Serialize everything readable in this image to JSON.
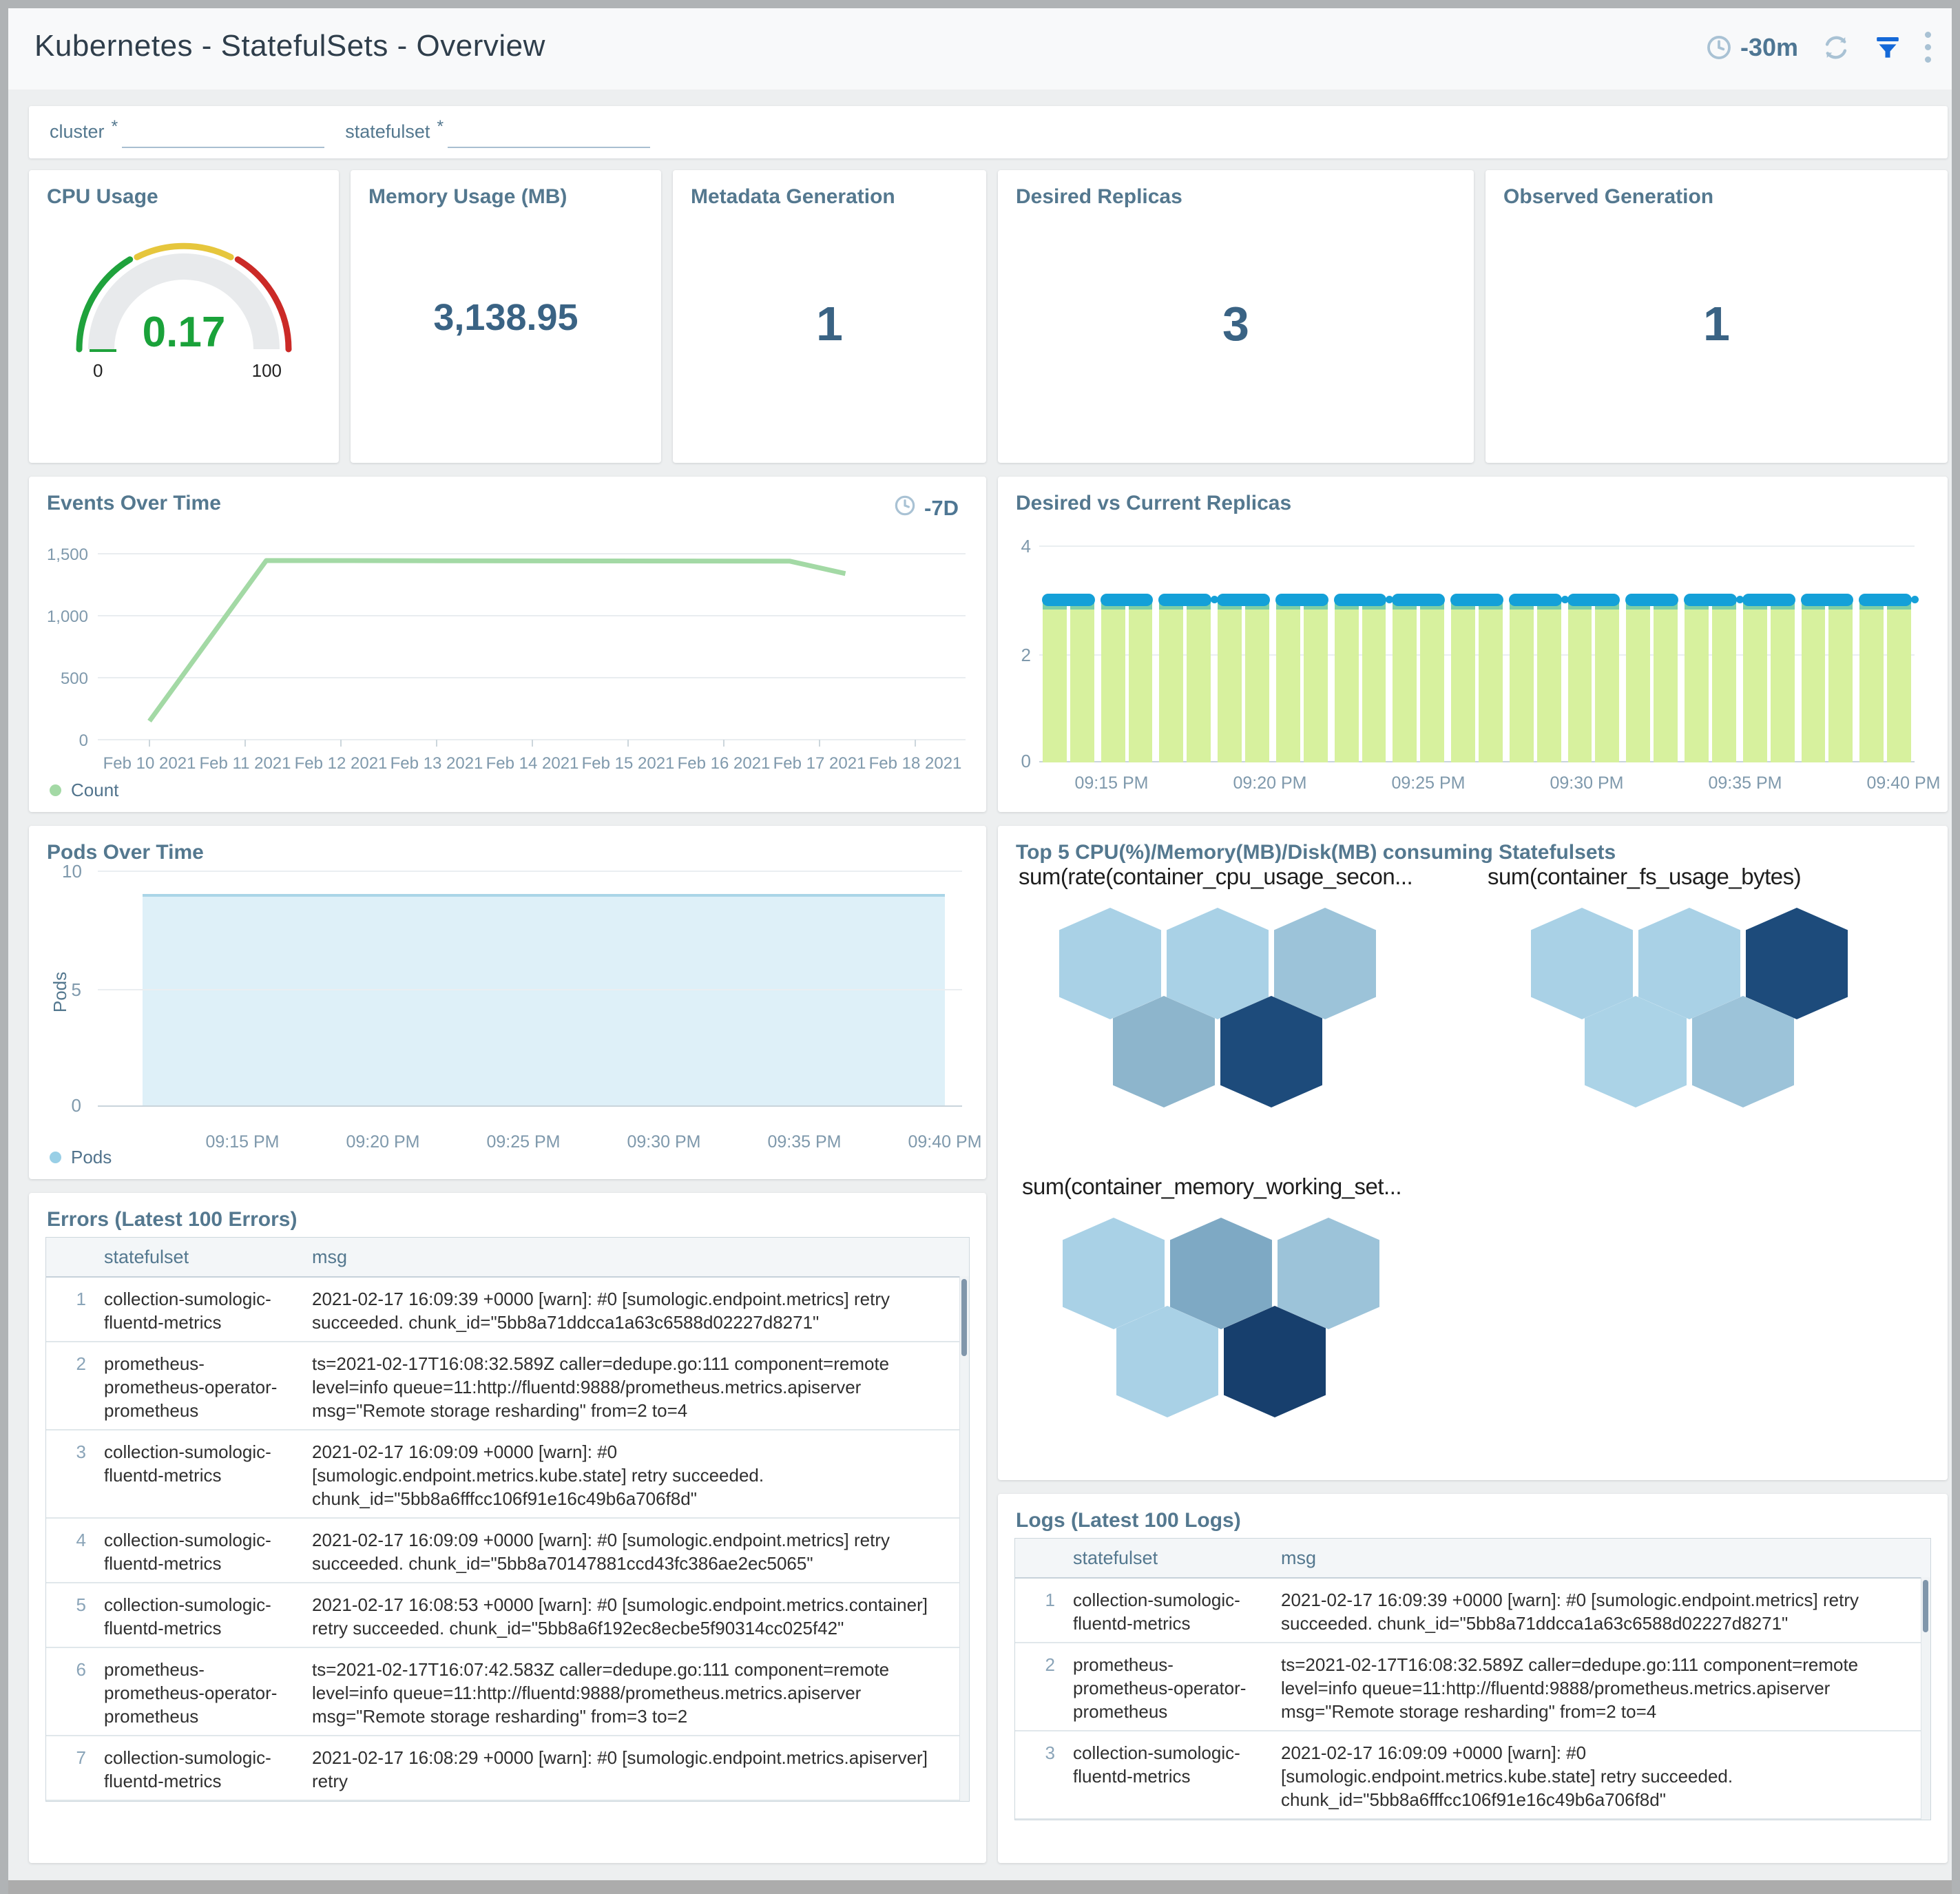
{
  "header": {
    "title": "Kubernetes - StatefulSets - Overview",
    "time_range": "-30m"
  },
  "filters": {
    "fields": [
      {
        "label": "cluster",
        "required_mark": "*",
        "value": ""
      },
      {
        "label": "statefulset",
        "required_mark": "*",
        "value": ""
      }
    ]
  },
  "stats": {
    "cpu": {
      "title": "CPU Usage",
      "value": "0.17",
      "scale_min": "0",
      "scale_max": "100",
      "value_color": "#1aa23a",
      "arc_colors": {
        "green": "#1fa23c",
        "yellow": "#e6c63c",
        "red": "#cb2a27"
      }
    },
    "memory": {
      "title": "Memory Usage (MB)",
      "value": "3,138.95"
    },
    "metadata_generation": {
      "title": "Metadata Generation",
      "value": "1"
    },
    "desired_replicas": {
      "title": "Desired Replicas",
      "value": "3"
    },
    "observed_generation": {
      "title": "Observed Generation",
      "value": "1"
    }
  },
  "chart_data": {
    "events": {
      "type": "line",
      "title": "Events Over Time",
      "time_range": "-7D",
      "legend": "Count",
      "color": "#a3d9a5",
      "ylim": [
        0,
        1500
      ],
      "y_values": [
        1500,
        1000,
        500,
        0
      ],
      "y_ticks": [
        "1,500",
        "1,000",
        "500",
        "0"
      ],
      "x_ticks": [
        "Feb 10 2021",
        "Feb 11 2021",
        "Feb 12 2021",
        "Feb 13 2021",
        "Feb 14 2021",
        "Feb 15 2021",
        "Feb 16 2021",
        "Feb 17 2021",
        "Feb 18 2021"
      ],
      "points": [
        [
          0,
          150
        ],
        [
          1.22,
          1445
        ],
        [
          6.69,
          1440
        ],
        [
          7.27,
          1340
        ]
      ]
    },
    "replicas": {
      "type": "bar",
      "title": "Desired vs Current Replicas",
      "desired": 3,
      "current": 3,
      "ylim": [
        0,
        4
      ],
      "y_ticks": [
        "4",
        "2",
        "0"
      ],
      "x_ticks": [
        "09:15 PM",
        "09:20 PM",
        "09:25 PM",
        "09:30 PM",
        "09:35 PM",
        "09:40 PM"
      ],
      "groups": 15,
      "dot_groups": [
        3,
        6,
        9,
        12,
        15
      ],
      "bar_color": "#d7f19e",
      "current_color": "#7fcfa5",
      "marker_color": "#14a0d8"
    },
    "pods": {
      "type": "area",
      "title": "Pods Over Time",
      "ylabel": "Pods",
      "legend": "Pods",
      "value": 9,
      "ylim": [
        0,
        10
      ],
      "y_ticks": [
        "10",
        "5",
        "0"
      ],
      "x_ticks": [
        "09:15 PM",
        "09:20 PM",
        "09:25 PM",
        "09:30 PM",
        "09:35 PM",
        "09:40 PM"
      ],
      "fill": "#def0f8",
      "line": "#aad5e7"
    },
    "honeycomb": {
      "type": "heatmap",
      "panel_title": "Top 5 CPU(%)/Memory(MB)/Disk(MB) consuming Statefulsets",
      "charts": [
        {
          "title": "sum(rate(container_cpu_usage_secon...",
          "cells": [
            "#a9d1e6",
            "#a9d1e6",
            "#9cc3d9",
            "#8db5cc",
            "#1d4b7b"
          ],
          "pos": [
            30,
            55
          ],
          "grid_left": 59
        },
        {
          "title": "sum(container_fs_usage_bytes)",
          "cells": [
            "#a9d1e6",
            "#a9d1e6",
            "#1d4b7b",
            "#abd3e7",
            "#9cc3d9"
          ],
          "pos": [
            711,
            55
          ],
          "grid_left": 63
        },
        {
          "title": "sum(container_memory_working_set...",
          "cells": [
            "#a9d1e6",
            "#7ea9c4",
            "#9cc3d9",
            "#a9d1e6",
            "#173f6d"
          ],
          "pos": [
            35,
            505
          ],
          "grid_left": 59
        }
      ]
    }
  },
  "errors_table": {
    "title": "Errors (Latest 100 Errors)",
    "columns": [
      "statefulset",
      "msg"
    ],
    "rows": [
      {
        "statefulset": "collection-sumologic-fluentd-metrics",
        "msg": "2021-02-17 16:09:39 +0000 [warn]: #0 [sumologic.endpoint.metrics] retry succeeded. chunk_id=\"5bb8a71ddcca1a63c6588d02227d8271\""
      },
      {
        "statefulset": "prometheus-prometheus-operator-prometheus",
        "msg": "ts=2021-02-17T16:08:32.589Z caller=dedupe.go:111 component=remote level=info queue=11:http://fluentd:9888/prometheus.metrics.apiserver msg=\"Remote storage resharding\" from=2 to=4"
      },
      {
        "statefulset": "collection-sumologic-fluentd-metrics",
        "msg": "2021-02-17 16:09:09 +0000 [warn]: #0 [sumologic.endpoint.metrics.kube.state] retry succeeded. chunk_id=\"5bb8a6fffcc106f91e16c49b6a706f8d\""
      },
      {
        "statefulset": "collection-sumologic-fluentd-metrics",
        "msg": "2021-02-17 16:09:09 +0000 [warn]: #0 [sumologic.endpoint.metrics] retry succeeded. chunk_id=\"5bb8a70147881ccd43fc386ae2ec5065\""
      },
      {
        "statefulset": "collection-sumologic-fluentd-metrics",
        "msg": "2021-02-17 16:08:53 +0000 [warn]: #0 [sumologic.endpoint.metrics.container] retry succeeded. chunk_id=\"5bb8a6f192ec8ecbe5f90314cc025f42\""
      },
      {
        "statefulset": "prometheus-prometheus-operator-prometheus",
        "msg": "ts=2021-02-17T16:07:42.583Z caller=dedupe.go:111 component=remote level=info queue=11:http://fluentd:9888/prometheus.metrics.apiserver msg=\"Remote storage resharding\" from=3 to=2"
      },
      {
        "statefulset": "collection-sumologic-fluentd-metrics",
        "msg": "2021-02-17 16:08:29 +0000 [warn]: #0 [sumologic.endpoint.metrics.apiserver] retry"
      }
    ]
  },
  "logs_table": {
    "title": "Logs (Latest 100 Logs)",
    "columns": [
      "statefulset",
      "msg"
    ],
    "rows": [
      {
        "statefulset": "collection-sumologic-fluentd-metrics",
        "msg": "2021-02-17 16:09:39 +0000 [warn]: #0 [sumologic.endpoint.metrics] retry succeeded. chunk_id=\"5bb8a71ddcca1a63c6588d02227d8271\""
      },
      {
        "statefulset": "prometheus-prometheus-operator-prometheus",
        "msg": "ts=2021-02-17T16:08:32.589Z caller=dedupe.go:111 component=remote level=info queue=11:http://fluentd:9888/prometheus.metrics.apiserver msg=\"Remote storage resharding\" from=2 to=4"
      },
      {
        "statefulset": "collection-sumologic-fluentd-metrics",
        "msg": "2021-02-17 16:09:09 +0000 [warn]: #0 [sumologic.endpoint.metrics.kube.state] retry succeeded. chunk_id=\"5bb8a6fffcc106f91e16c49b6a706f8d\""
      }
    ]
  }
}
